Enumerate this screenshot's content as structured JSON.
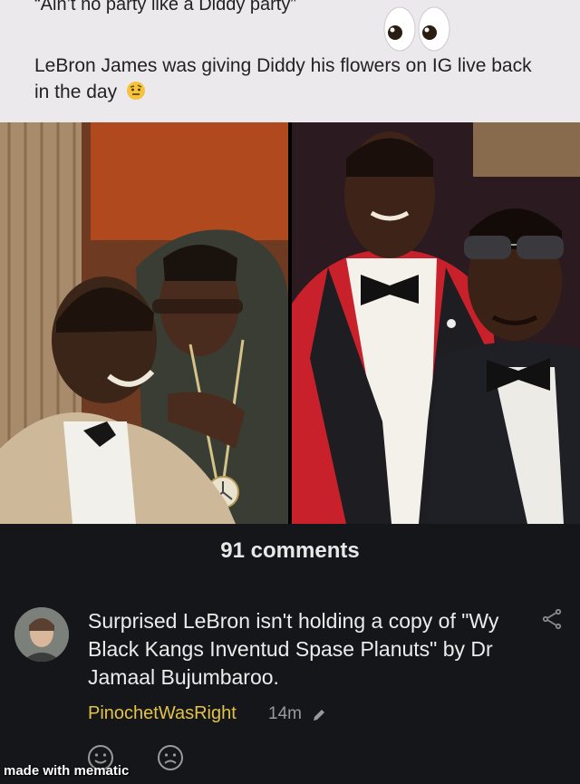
{
  "post": {
    "quote": "“Ain’t no party like a Diddy party”",
    "caption": "LeBron James was giving Diddy his flowers on IG live back in the day",
    "emoji_eyes": "eyes-emoji",
    "emoji_face": "raised-eyebrow-emoji"
  },
  "comments_section": {
    "title": "91 comments"
  },
  "comment": {
    "text": "Surprised LeBron isn't holding a copy of \"Wy Black Kangs Inventud Spase Planuts\" by Dr Jamaal Bujumbaroo.",
    "username": "PinochetWasRight",
    "time": "14m",
    "share_icon": "share-icon",
    "edit_icon": "pencil-icon"
  },
  "reactions": [
    "smile-icon",
    "frown-icon"
  ],
  "watermark": "made with mematic",
  "colors": {
    "background": "#15161a",
    "username": "#e2c24a",
    "header_bg": "#ebe9ec"
  }
}
